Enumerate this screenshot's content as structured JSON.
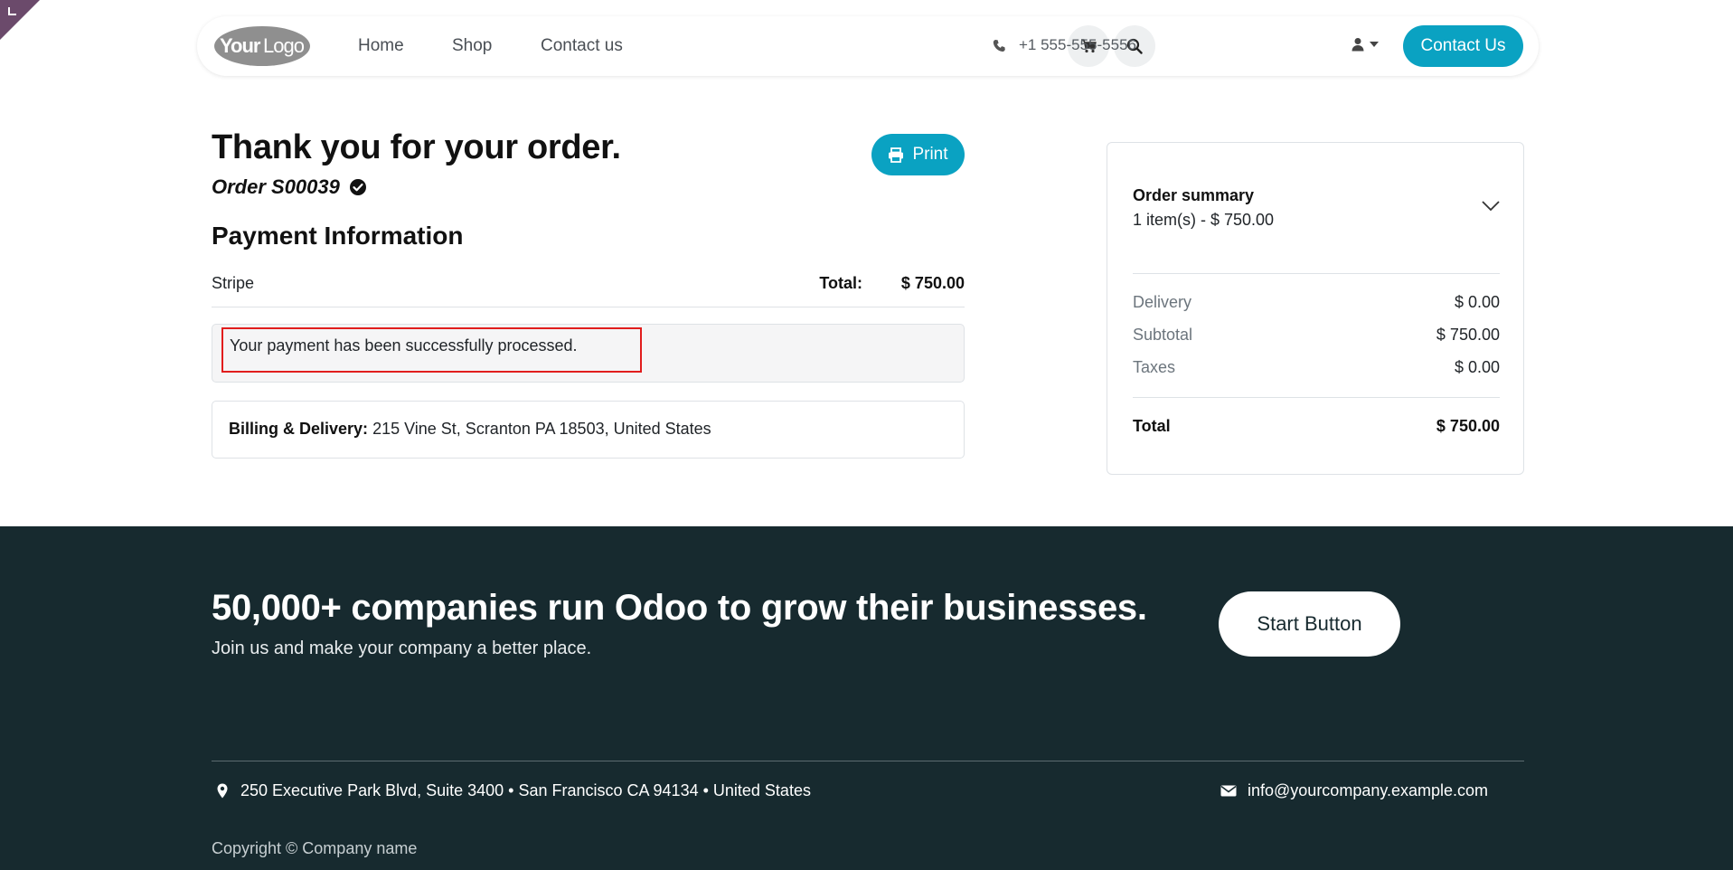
{
  "header": {
    "logo_text": "YourLogo",
    "nav": [
      "Home",
      "Shop",
      "Contact us"
    ],
    "phone": "+1 555-555-5556",
    "contact_button": "Contact Us"
  },
  "order": {
    "title": "Thank you for your order.",
    "reference": "Order S00039",
    "print_label": "Print",
    "payment_heading": "Payment Information",
    "payment_method": "Stripe",
    "total_label": "Total:",
    "total_value": "$ 750.00",
    "status_message": "Your payment has been successfully processed.",
    "address_label": "Billing & Delivery:",
    "address_value": "215 Vine St, Scranton PA 18503, United States"
  },
  "summary": {
    "title": "Order summary",
    "count": "1 item(s) -  $ 750.00",
    "lines": [
      {
        "label": "Delivery",
        "value": "$ 0.00"
      },
      {
        "label": "Subtotal",
        "value": "$ 750.00"
      },
      {
        "label": "Taxes",
        "value": "$ 0.00"
      }
    ],
    "total_label": "Total",
    "total_value": "$ 750.00"
  },
  "footer": {
    "headline": "50,000+ companies run Odoo to grow their businesses.",
    "subline": "Join us and make your company a better place.",
    "start_button": "Start Button",
    "address": "250 Executive Park Blvd, Suite 3400 • San Francisco CA 94134 • United States",
    "email": "info@yourcompany.example.com",
    "copyright": "Copyright © Company name"
  },
  "colors": {
    "accent": "#0aa2c2",
    "footer_bg": "#172a2f",
    "highlight": "#e11d1d",
    "corner": "#6b4a6b"
  },
  "icons": [
    "cart-icon",
    "search-icon",
    "phone-icon",
    "user-icon",
    "caret-down-icon",
    "printer-icon",
    "check-circle-icon",
    "chevron-down-icon",
    "map-marker-icon",
    "envelope-icon"
  ]
}
